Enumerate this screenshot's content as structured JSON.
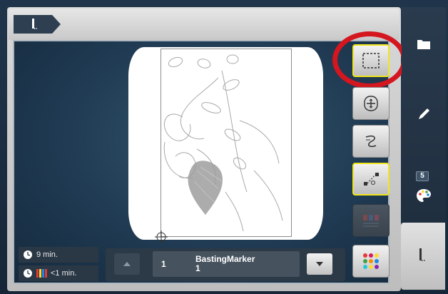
{
  "sidebar": {
    "color_count": "5"
  },
  "status": {
    "total_time": "9 min.",
    "color_time": "<1 min."
  },
  "design": {
    "index": "1",
    "name": "BastingMarker",
    "subname": "1"
  },
  "colors": {
    "accent_selected": "#f1e51a",
    "highlight_circle": "#d4161f"
  },
  "icons": {
    "tab": "needle-icon",
    "folder": "folder-icon",
    "edit": "pencil-icon",
    "palette": "palette-icon",
    "stitch": "needle-icon",
    "basting": "basting-box-icon",
    "move": "move-arrows-icon",
    "stitch_path": "stitch-path-icon",
    "cut": "cut-connect-icon",
    "color_blocks": "color-blocks-icon",
    "color_dots": "color-dots-icon"
  }
}
